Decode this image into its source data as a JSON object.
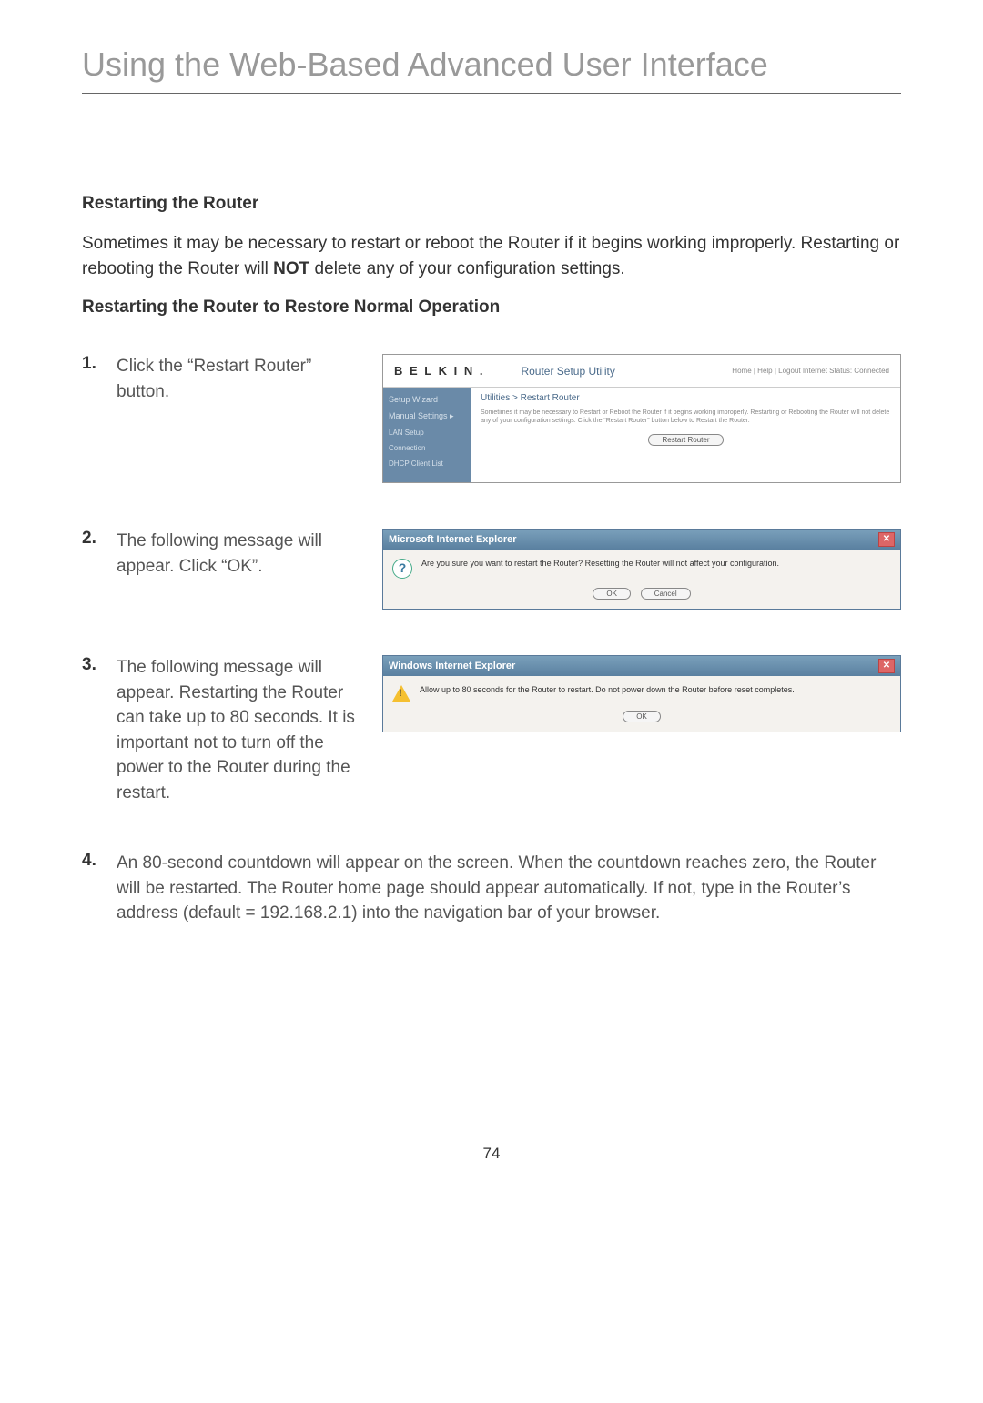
{
  "page": {
    "title": "Using the Web-Based Advanced User Interface",
    "number": "74"
  },
  "section": {
    "heading1": "Restarting the Router",
    "intro_prefix": "Sometimes it may be necessary to restart or reboot the Router if it begins working improperly. Restarting or rebooting the Router will ",
    "intro_bold": "NOT",
    "intro_suffix": " delete any of your configuration settings.",
    "heading2": "Restarting the Router to Restore Normal Operation"
  },
  "steps": {
    "s1": {
      "num": "1.",
      "text": "Click the “Restart Router” button."
    },
    "s2": {
      "num": "2.",
      "text": "The following message will appear. Click “OK”."
    },
    "s3": {
      "num": "3.",
      "text": "The following message will appear. Restarting the Router can take up to 80 seconds. It is important not to turn off the power to the Router during the restart."
    },
    "s4": {
      "num": "4.",
      "text": "An 80-second countdown will appear on the screen. When the countdown reaches zero, the Router will be restarted. The Router home page should appear automatically. If not, type in the Router’s address (default = 192.168.2.1) into the navigation bar of your browser."
    }
  },
  "shot1": {
    "logo": "B E L K I N .",
    "title": "Router Setup Utility",
    "links": "Home | Help | Logout   Internet Status: Connected",
    "side": {
      "a": "Setup Wizard",
      "b": "Manual Settings ▸",
      "c": "LAN Setup",
      "d": "Connection",
      "e": "DHCP Client List"
    },
    "crumb": "Utilities > Restart Router",
    "desc": "Sometimes it may be necessary to Restart or Reboot the Router if it begins working improperly. Restarting or Rebooting the Router will not delete any of your configuration settings. Click the “Restart Router” button below to Restart the Router.",
    "button": "Restart Router"
  },
  "dialog2": {
    "title": "Microsoft Internet Explorer",
    "msg": "Are you sure you want to restart the Router? Resetting the Router will not affect your configuration.",
    "ok": "OK",
    "cancel": "Cancel"
  },
  "dialog3": {
    "title": "Windows Internet Explorer",
    "msg": "Allow up to 80 seconds for the Router to restart. Do not power down the Router before reset completes.",
    "ok": "OK"
  }
}
